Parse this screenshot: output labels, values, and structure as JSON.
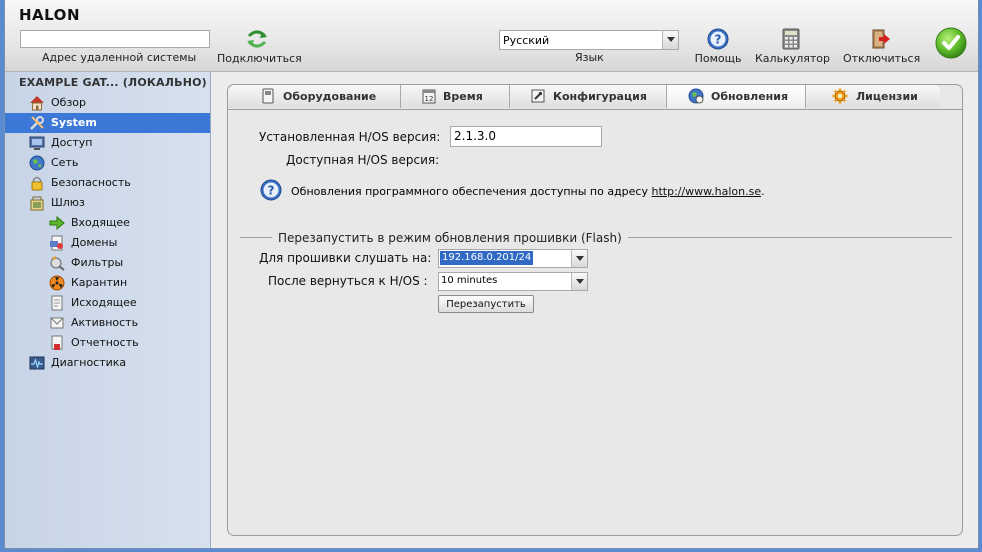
{
  "app": {
    "logo": "HALON"
  },
  "toolbar": {
    "remote_label": "Адрес удаленной системы",
    "remote_value": "",
    "connect_label": "Подключиться",
    "language_value": "Русский",
    "language_label": "Язык",
    "help_label": "Помощь",
    "calculator_label": "Калькулятор",
    "disconnect_label": "Отключиться",
    "icons": {
      "connect": "refresh-arrow-icon",
      "help": "help-icon",
      "calculator": "calculator-icon",
      "disconnect": "exit-door-icon",
      "status": "checkmark-icon"
    }
  },
  "sidebar": {
    "header": "EXAMPLE GAT... (ЛОКАЛЬНО)",
    "items": [
      {
        "label": "Обзор",
        "icon": "home-icon"
      },
      {
        "label": "System",
        "icon": "tools-icon",
        "active": true
      },
      {
        "label": "Доступ",
        "icon": "monitor-icon"
      },
      {
        "label": "Сеть",
        "icon": "globe-icon"
      },
      {
        "label": "Безопасность",
        "icon": "lock-icon"
      },
      {
        "label": "Шлюз",
        "icon": "gateway-icon"
      },
      {
        "label": "Входящее",
        "icon": "incoming-arrow-icon"
      },
      {
        "label": "Домены",
        "icon": "domains-icon"
      },
      {
        "label": "Фильтры",
        "icon": "filters-icon"
      },
      {
        "label": "Карантин",
        "icon": "quarantine-icon"
      },
      {
        "label": "Исходящее",
        "icon": "outgoing-icon"
      },
      {
        "label": "Активность",
        "icon": "activity-icon"
      },
      {
        "label": "Отчетность",
        "icon": "reports-icon"
      },
      {
        "label": "Диагностика",
        "icon": "diagnostics-icon"
      }
    ]
  },
  "tabs": [
    {
      "label": "Оборудование",
      "icon": "hardware-icon"
    },
    {
      "label": "Время",
      "icon": "calendar-icon"
    },
    {
      "label": "Конфигурация",
      "icon": "configuration-icon"
    },
    {
      "label": "Обновления",
      "icon": "update-globe-icon",
      "active": true
    },
    {
      "label": "Лицензии",
      "icon": "license-gear-icon"
    }
  ],
  "updates": {
    "installed_label": "Установленная H/OS версия:",
    "installed_value": "2.1.3.0",
    "available_label": "Доступная H/OS версия:",
    "available_value": "",
    "info_text": "Обновления программного обеспечения доступны по адресу",
    "info_link": "http://www.halon.se",
    "info_suffix": ".",
    "flash_legend": "Перезапустить в режим обновления прошивки (Flash)",
    "listen_label": "Для прошивки слушать на:",
    "listen_value": "192.168.0.201/24",
    "return_label": "После вернуться к H/OS :",
    "return_value": "10 minutes",
    "restart_label": "Перезапустить"
  },
  "colors": {
    "accent": "#3c78d8",
    "sidebar_bg": "#cfdbeb",
    "content_bg": "#e8e8e8",
    "status_ok": "#4caf1a"
  }
}
